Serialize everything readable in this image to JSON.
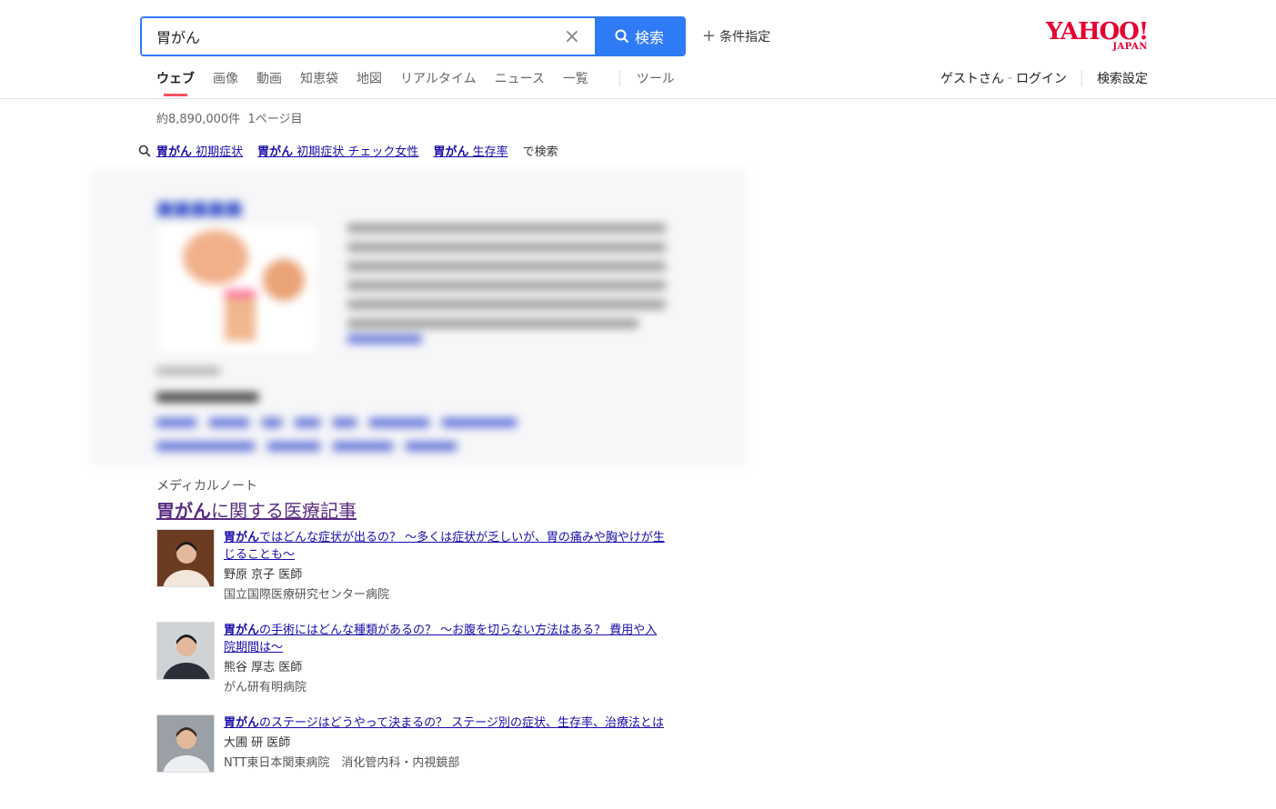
{
  "search": {
    "query": "胃がん",
    "clear_label": "×",
    "button_label": "検索",
    "conditions_label": "条件指定"
  },
  "logo": {
    "main": "YAHOO!",
    "sub": "JAPAN"
  },
  "nav": {
    "tabs": [
      {
        "label": "ウェブ",
        "active": true
      },
      {
        "label": "画像"
      },
      {
        "label": "動画"
      },
      {
        "label": "知恵袋"
      },
      {
        "label": "地図"
      },
      {
        "label": "リアルタイム"
      },
      {
        "label": "ニュース"
      },
      {
        "label": "一覧"
      }
    ],
    "tools_label": "ツール"
  },
  "user": {
    "guest": "ゲストさん",
    "dash": "-",
    "login": "ログイン",
    "settings": "検索設定"
  },
  "results": {
    "count": "約8,890,000件",
    "page": "1ページ目"
  },
  "related": {
    "items": [
      {
        "bold": "胃がん",
        "rest": " 初期症状"
      },
      {
        "bold": "胃がん",
        "rest": " 初期症状 チェック女性"
      },
      {
        "bold": "胃がん",
        "rest": " 生存率"
      }
    ],
    "suffix": "で検索"
  },
  "medical_note": {
    "source": "メディカルノート",
    "title_bold": "胃がん",
    "title_rest": "に関する医療記事",
    "articles": [
      {
        "title_bold": "胃がん",
        "title_rest": "ではどんな症状が出るの？ 〜多くは症状が乏しいが、胃の痛みや胸やけが生じることも〜",
        "doctor": "野原 京子 医師",
        "hospital": "国立国際医療研究センター病院"
      },
      {
        "title_bold": "胃がん",
        "title_rest": "の手術にはどんな種類があるの？ 〜お腹を切らない方法はある？ 費用や入院期間は〜",
        "doctor": "熊谷 厚志 医師",
        "hospital": "がん研有明病院"
      },
      {
        "title_bold": "胃がん",
        "title_rest": "のステージはどうやって決まるの？ ステージ別の症状、生存率、治療法とは",
        "doctor": "大圃 研 医師",
        "hospital": "NTT東日本関東病院　消化管内科・内視鏡部"
      }
    ]
  },
  "colors": {
    "accent": "#2f7bf5",
    "brand": "#e60033",
    "link": "#1a0dab",
    "visited": "#5a2d82",
    "active_tab": "#ff5060"
  }
}
